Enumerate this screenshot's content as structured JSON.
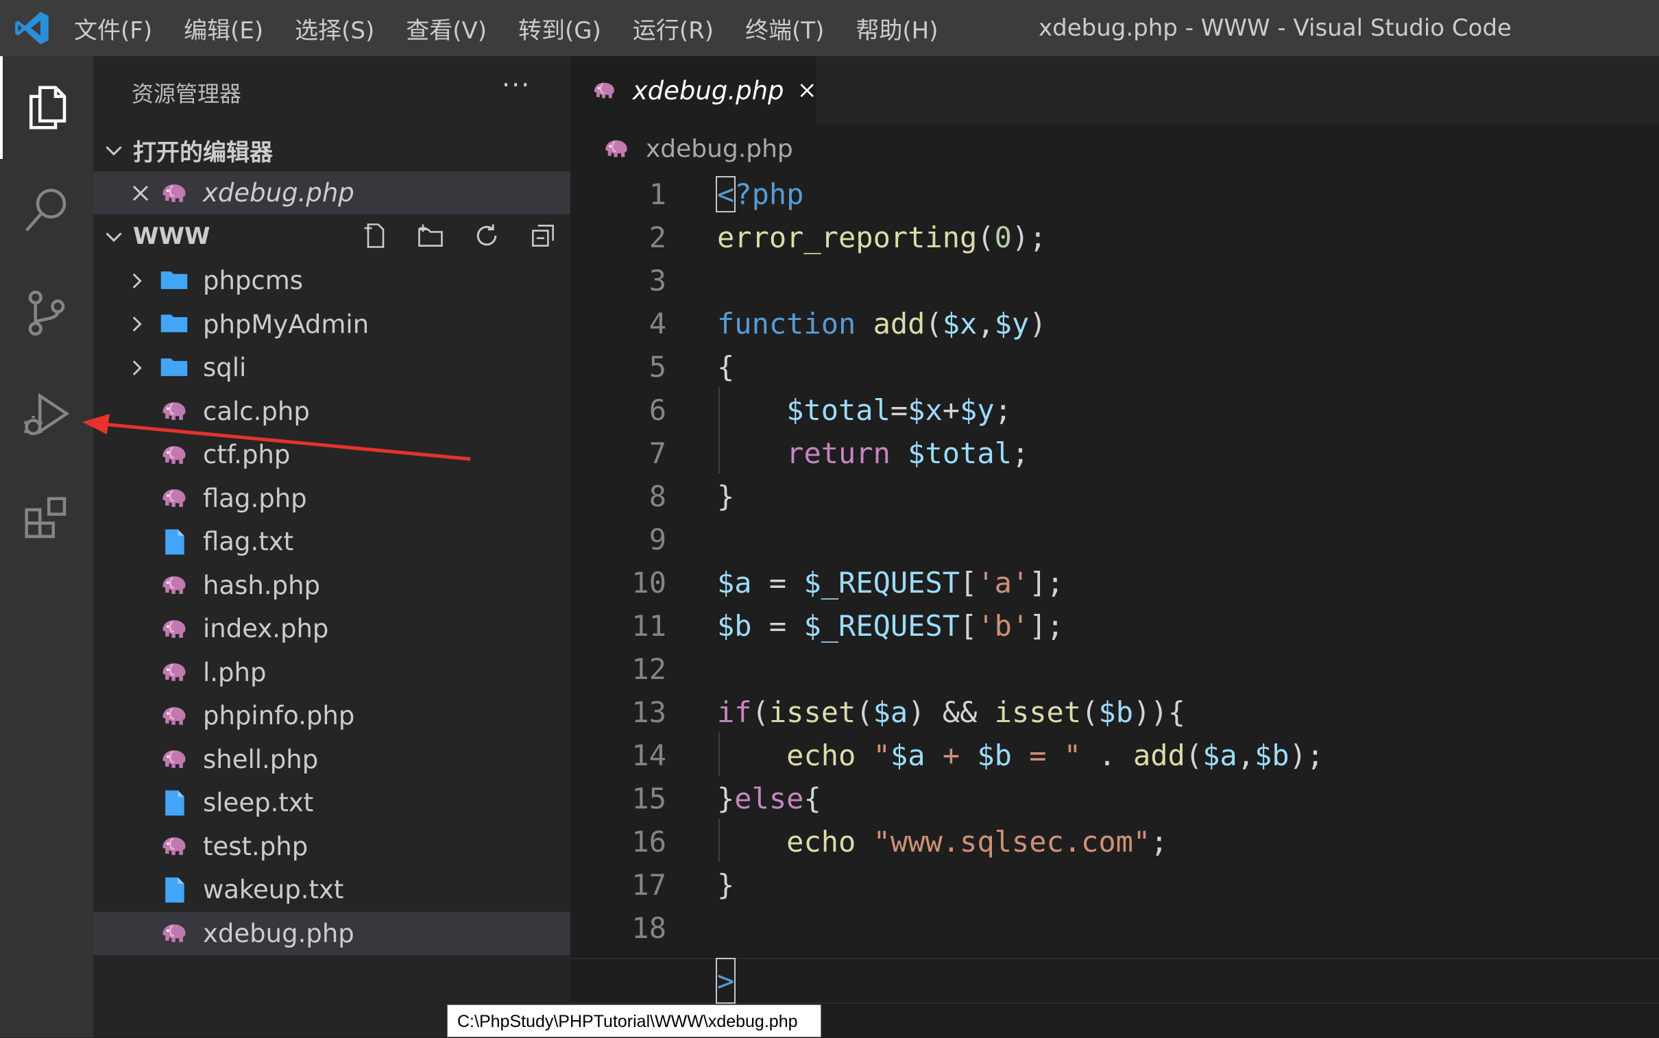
{
  "window": {
    "title": "xdebug.php - WWW - Visual Studio Code"
  },
  "menu": [
    "文件(F)",
    "编辑(E)",
    "选择(S)",
    "查看(V)",
    "转到(G)",
    "运行(R)",
    "终端(T)",
    "帮助(H)"
  ],
  "sidebar": {
    "title": "资源管理器",
    "more": "···",
    "open_editors": {
      "header": "打开的编辑器",
      "items": [
        "xdebug.php"
      ]
    },
    "workspace": {
      "header": "WWW",
      "items": [
        {
          "name": "phpcms",
          "icon": "folder-icon"
        },
        {
          "name": "phpMyAdmin",
          "icon": "folder-icon"
        },
        {
          "name": "sqli",
          "icon": "folder-icon"
        },
        {
          "name": "calc.php",
          "icon": "php-elephant-icon"
        },
        {
          "name": "ctf.php",
          "icon": "php-elephant-icon"
        },
        {
          "name": "flag.php",
          "icon": "php-elephant-icon"
        },
        {
          "name": "flag.txt",
          "icon": "text-file-icon"
        },
        {
          "name": "hash.php",
          "icon": "php-elephant-icon"
        },
        {
          "name": "index.php",
          "icon": "php-elephant-icon"
        },
        {
          "name": "l.php",
          "icon": "php-elephant-icon"
        },
        {
          "name": "phpinfo.php",
          "icon": "php-elephant-icon"
        },
        {
          "name": "shell.php",
          "icon": "php-elephant-icon"
        },
        {
          "name": "sleep.txt",
          "icon": "text-file-icon"
        },
        {
          "name": "test.php",
          "icon": "php-elephant-icon"
        },
        {
          "name": "wakeup.txt",
          "icon": "text-file-icon"
        },
        {
          "name": "xdebug.php",
          "icon": "php-elephant-icon"
        }
      ]
    },
    "tooltip": "C:\\PhpStudy\\PHPTutorial\\WWW\\xdebug.php"
  },
  "editor": {
    "tab_label": "xdebug.php",
    "breadcrumb": "xdebug.php",
    "line_numbers": [
      "1",
      "2",
      "3",
      "4",
      "5",
      "6",
      "7",
      "8",
      "9",
      "10",
      "11",
      "12",
      "13",
      "14",
      "15",
      "16",
      "17",
      "18"
    ],
    "code_lines": [
      "<?php",
      "error_reporting(0);",
      "",
      "function add($x,$y)",
      "{",
      "    $total=$x+$y;",
      "    return $total;",
      "}",
      "",
      "$a = $_REQUEST['a'];",
      "$b = $_REQUEST['b'];",
      "",
      "if(isset($a) && isset($b)){",
      "    echo \"$a + $b = \" . add($a,$b);",
      "}else{",
      "    echo \"www.sqlsec.com\";",
      "}",
      ""
    ],
    "extra_line_text": ">"
  },
  "colors": {
    "keyword": "#569cd6",
    "function": "#dcdcaa",
    "variable": "#9cdcfe",
    "number": "#b5cea8",
    "string": "#ce9178",
    "control": "#c586c0",
    "annotation_arrow": "#e8322c"
  }
}
